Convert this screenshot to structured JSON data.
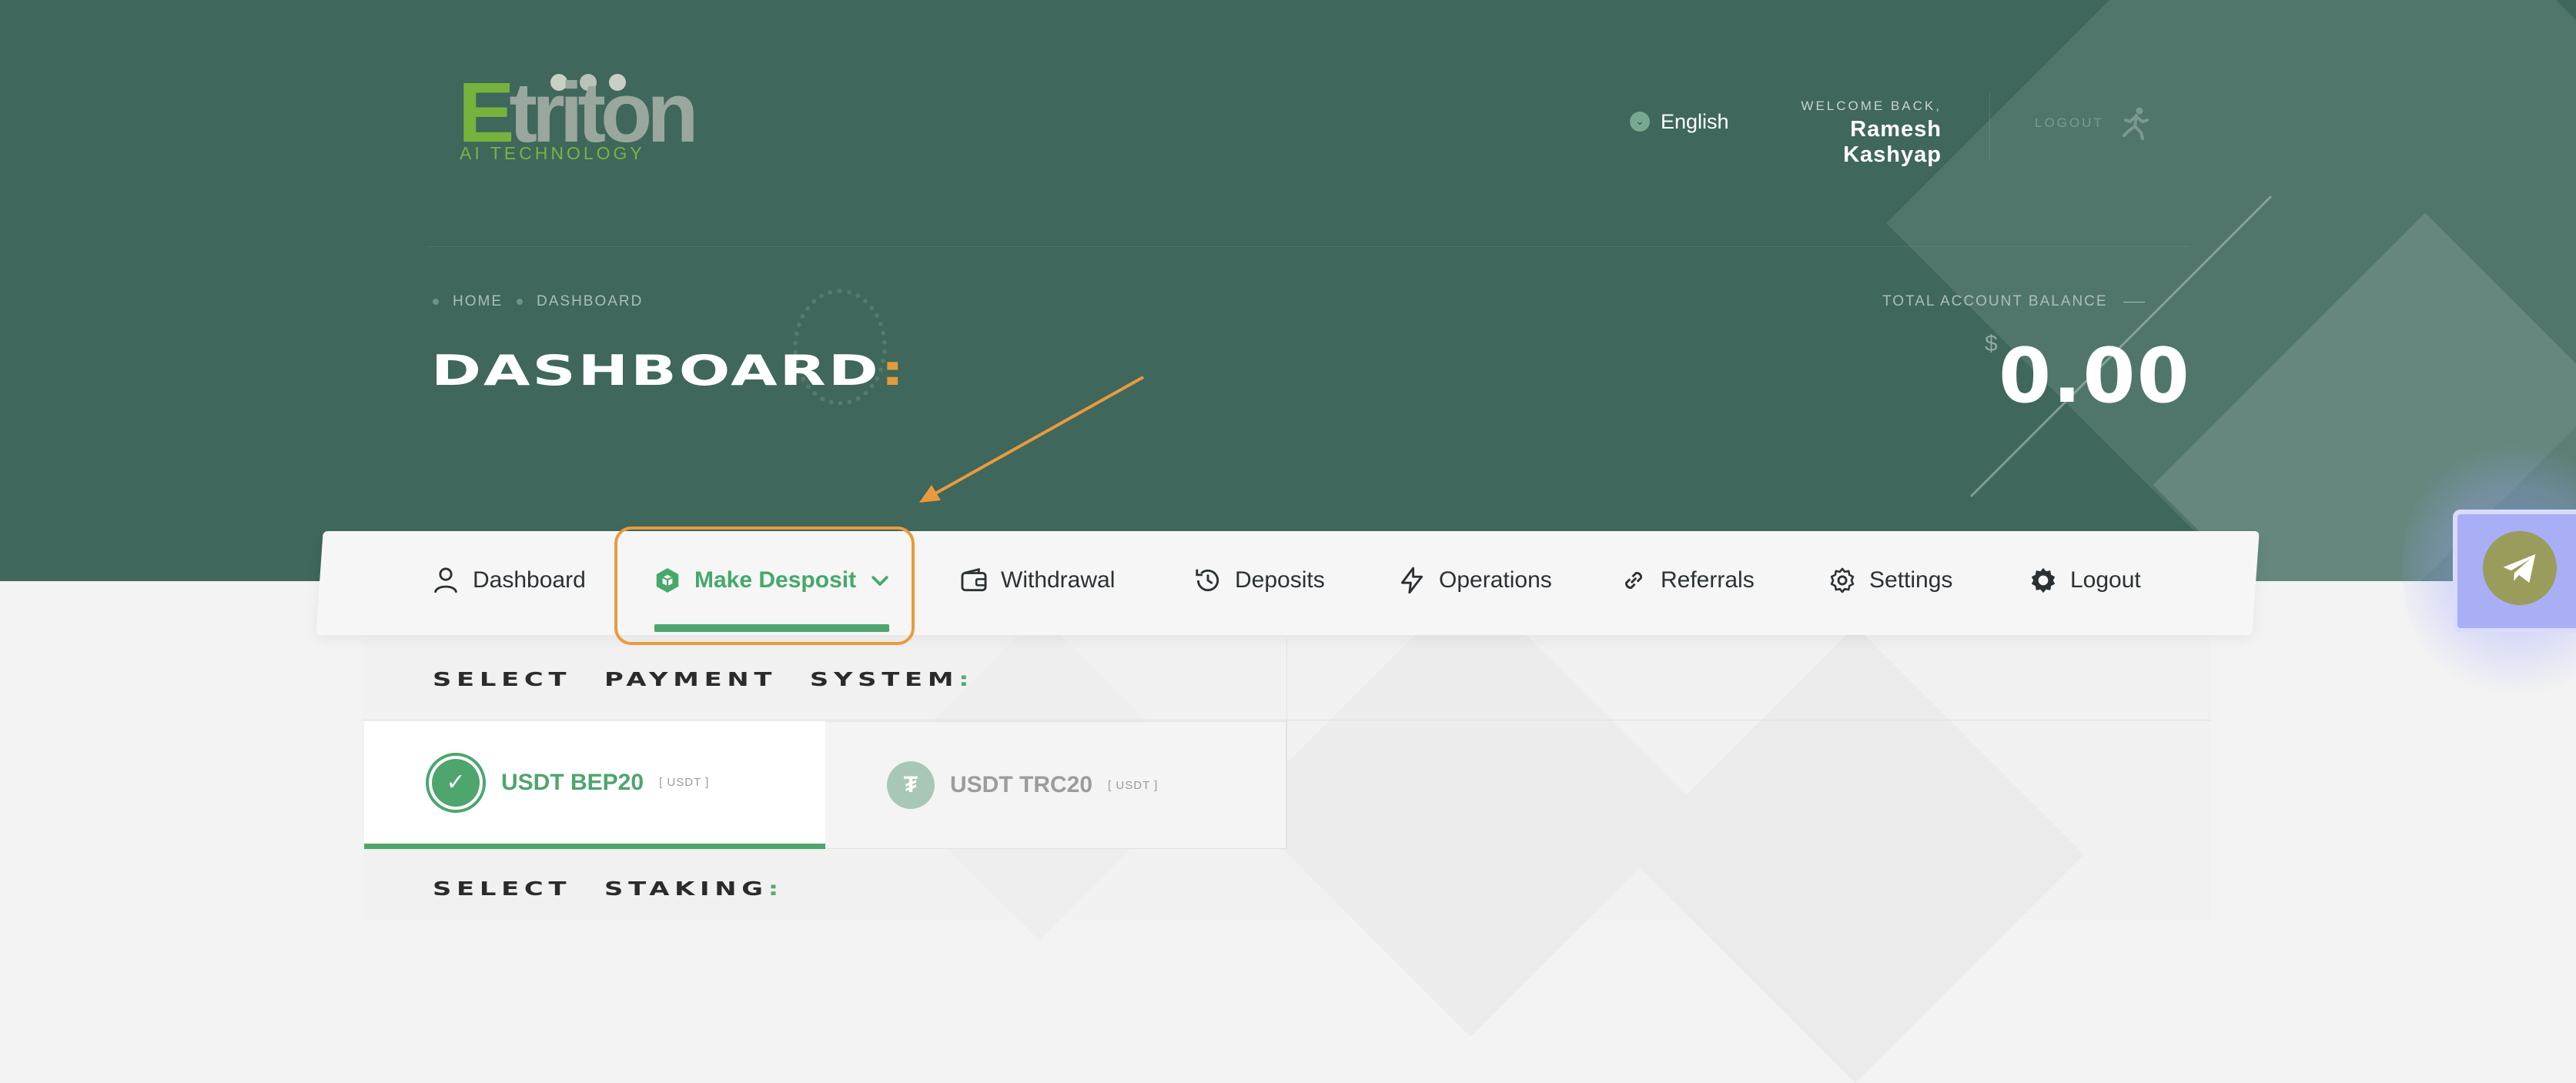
{
  "brand": {
    "logo_initial": "E",
    "logo_rest": "triton",
    "logo_sub": "AI TECHNOLOGY"
  },
  "header": {
    "language": "English",
    "welcome_label": "WELCOME BACK,",
    "user_name": "Ramesh Kashyap",
    "logout_label": "LOGOUT"
  },
  "breadcrumb": {
    "home": "HOME",
    "current": "DASHBOARD"
  },
  "page": {
    "title": "DASHBOARD",
    "title_colon": ":"
  },
  "balance": {
    "label": "TOTAL ACCOUNT BALANCE",
    "currency": "$",
    "value": "0.00"
  },
  "nav": {
    "items": [
      {
        "label": "Dashboard",
        "icon": "user-icon"
      },
      {
        "label": "Make Desposit",
        "icon": "cube-icon"
      },
      {
        "label": "Withdrawal",
        "icon": "wallet-icon"
      },
      {
        "label": "Deposits",
        "icon": "history-icon"
      },
      {
        "label": "Operations",
        "icon": "lightning-icon"
      },
      {
        "label": "Referrals",
        "icon": "link-icon"
      },
      {
        "label": "Settings",
        "icon": "gear-icon"
      },
      {
        "label": "Logout",
        "icon": "gear-icon"
      }
    ],
    "active": "Make Desposit"
  },
  "payment": {
    "title": "SELECT PAYMENT SYSTEM",
    "title_colon": ":",
    "options": [
      {
        "name": "USDT BEP20",
        "tag": "[ USDT ]",
        "selected": true
      },
      {
        "name": "USDT TRC20",
        "tag": "[ USDT ]",
        "selected": false,
        "icon_glyph": "₮"
      }
    ]
  },
  "staking": {
    "title": "SELECT STAKING",
    "title_colon": ":"
  },
  "colors": {
    "header_bg": "#3f675c",
    "accent_green": "#4ea56d",
    "highlight_orange": "#ea9a3e"
  }
}
